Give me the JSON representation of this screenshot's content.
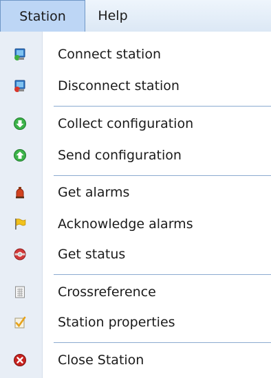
{
  "menubar": {
    "station": "Station",
    "help": "Help"
  },
  "menu": {
    "items": [
      {
        "label": "Connect station",
        "icon": "monitor-connect-icon"
      },
      {
        "label": "Disconnect station",
        "icon": "monitor-disconnect-icon"
      },
      {
        "label": "Collect configuration",
        "icon": "green-arrow-down-icon"
      },
      {
        "label": "Send configuration",
        "icon": "green-arrow-up-icon"
      },
      {
        "label": "Get alarms",
        "icon": "alarm-bell-icon"
      },
      {
        "label": "Acknowledge alarms",
        "icon": "yellow-flag-icon"
      },
      {
        "label": "Get status",
        "icon": "status-lifebuoy-icon"
      },
      {
        "label": "Crossreference",
        "icon": "document-grid-icon"
      },
      {
        "label": "Station properties",
        "icon": "properties-check-icon"
      },
      {
        "label": "Close Station",
        "icon": "red-close-icon"
      }
    ]
  }
}
